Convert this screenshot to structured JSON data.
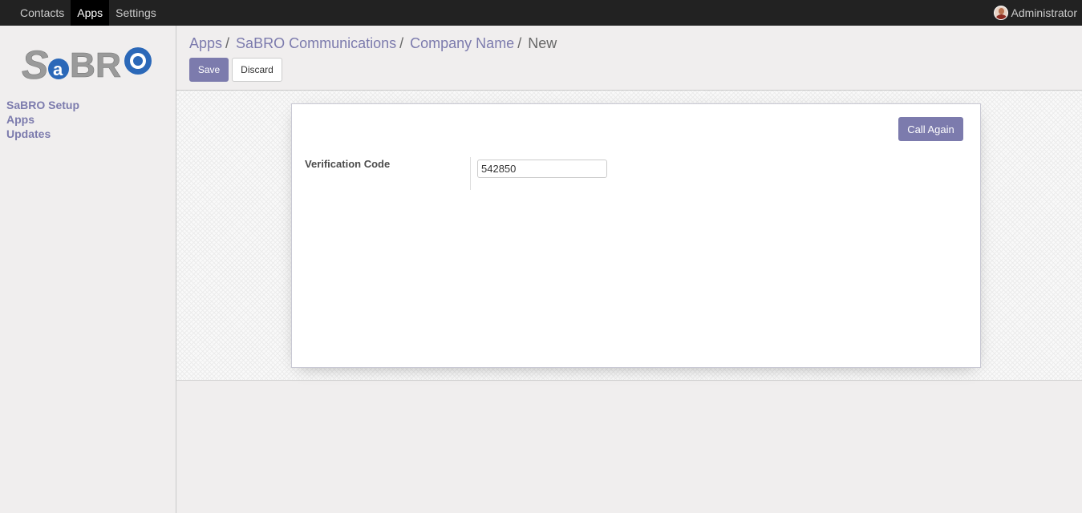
{
  "topbar": {
    "menu": [
      {
        "label": "Contacts",
        "active": false
      },
      {
        "label": "Apps",
        "active": true
      },
      {
        "label": "Settings",
        "active": false
      }
    ],
    "user_name": "Administrator"
  },
  "sidebar": {
    "logo_text": "SaBRO",
    "links": [
      "SaBRO Setup",
      "Apps",
      "Updates"
    ]
  },
  "breadcrumb": {
    "items": [
      "Apps",
      "SaBRO Communications",
      "Company Name"
    ],
    "current": "New"
  },
  "buttons": {
    "save": "Save",
    "discard": "Discard",
    "call_again": "Call Again"
  },
  "form": {
    "verification_label": "Verification Code",
    "verification_value": "542850"
  },
  "colors": {
    "accent": "#7c7bad",
    "navbar": "#222222",
    "logo_gray": "#9a9a9a",
    "logo_blue": "#2b68b8"
  }
}
